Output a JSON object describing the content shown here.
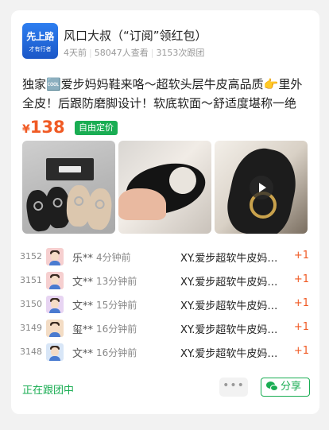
{
  "header": {
    "avatar_text_big": "先上路",
    "avatar_text_small": "才有行者",
    "title": "风口大叔（“订阅”领红包）",
    "time_ago": "4天前",
    "views": "58047人查看",
    "follow_count": "3153次跟团"
  },
  "product": {
    "description": "独家🆒爱步妈妈鞋来咯～超软头层牛皮高品质👉里外全皮！后跟防磨脚设计！软底软面～舒适度堪称一绝",
    "currency": "¥",
    "price": "138",
    "price_tag": "自由定价",
    "images": [
      {
        "alt": "shoes-group-photo"
      },
      {
        "alt": "shoe-in-hand-photo"
      },
      {
        "alt": "shoe-closeup-video"
      }
    ],
    "brand_on_box": "ecco"
  },
  "followers": [
    {
      "index": "3152",
      "name": "乐**",
      "time": "4分钟前",
      "product": "XY.爱步超软牛皮妈妈鞋",
      "qty": "+1"
    },
    {
      "index": "3151",
      "name": "文**",
      "time": "13分钟前",
      "product": "XY.爱步超软牛皮妈妈鞋",
      "qty": "+1"
    },
    {
      "index": "3150",
      "name": "文**",
      "time": "15分钟前",
      "product": "XY.爱步超软牛皮妈妈鞋",
      "qty": "+1"
    },
    {
      "index": "3149",
      "name": "玺**",
      "time": "16分钟前",
      "product": "XY.爱步超软牛皮妈妈鞋",
      "qty": "+1"
    },
    {
      "index": "3148",
      "name": "文**",
      "time": "16分钟前",
      "product": "XY.爱步超软牛皮妈妈鞋",
      "qty": "+1"
    }
  ],
  "footer": {
    "status": "正在跟团中",
    "more_label": "•••",
    "share_label": "分享"
  },
  "colors": {
    "accent_green": "#1aad53",
    "price_orange": "#f05a24"
  }
}
